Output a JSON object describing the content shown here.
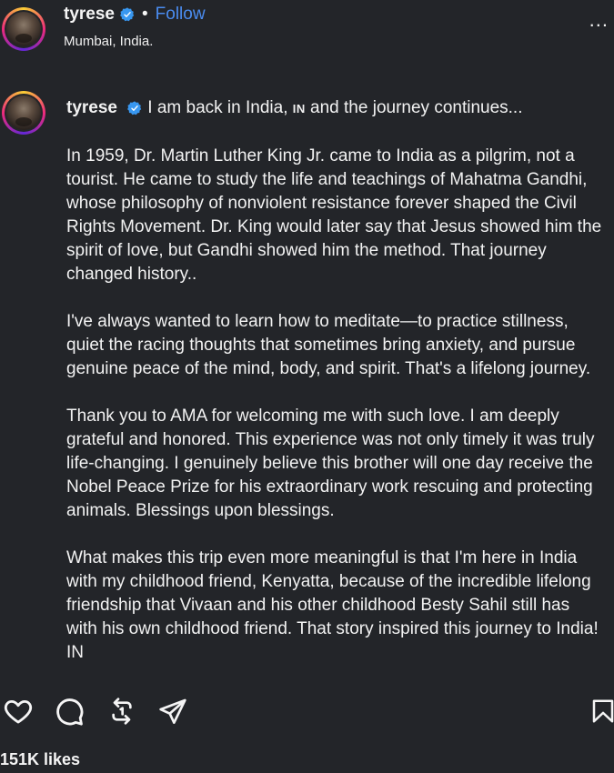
{
  "header": {
    "username": "tyrese",
    "separator": "•",
    "follow_label": "Follow",
    "location": "Mumbai, India.",
    "more_label": "..."
  },
  "caption": {
    "author": "tyrese",
    "first_line": "I am back in India,",
    "flag_text": "IN",
    "first_line_end": "and the journey continues...",
    "paragraphs": [
      "In 1959, Dr. Martin Luther King Jr. came to India as a pilgrim, not a tourist. He came to study the life and teachings of Mahatma Gandhi, whose philosophy of nonviolent resistance forever shaped the Civil Rights Movement. Dr. King would later say that Jesus showed him the spirit of love, but Gandhi showed him the method. That journey changed history..",
      "I've always wanted to learn how to meditate—to practice stillness, quiet the racing thoughts that sometimes bring anxiety, and pursue genuine peace of the mind, body, and spirit. That's a lifelong journey.",
      "Thank you to AMA for welcoming me with such love. I am deeply grateful and honored. This experience was not only timely it was truly life-changing. I genuinely believe this brother will one day receive the Nobel Peace Prize for his extraordinary work rescuing and protecting animals. Blessings upon blessings.",
      "What makes this trip even more meaningful is that I'm here in India with my childhood friend, Kenyatta, because of the incredible lifelong friendship that Vivaan and his other childhood Besty Sahil still has with his own childhood friend. That story inspired this journey to India! IN"
    ]
  },
  "actions": {
    "like_icon": "heart-icon",
    "comment_icon": "comment-icon",
    "repost_icon": "repost-icon",
    "share_icon": "share-icon",
    "save_icon": "bookmark-icon"
  },
  "likes": "151K likes",
  "colors": {
    "background": "#232529",
    "accent": "#4a8cf0",
    "verified": "#3897f0"
  }
}
